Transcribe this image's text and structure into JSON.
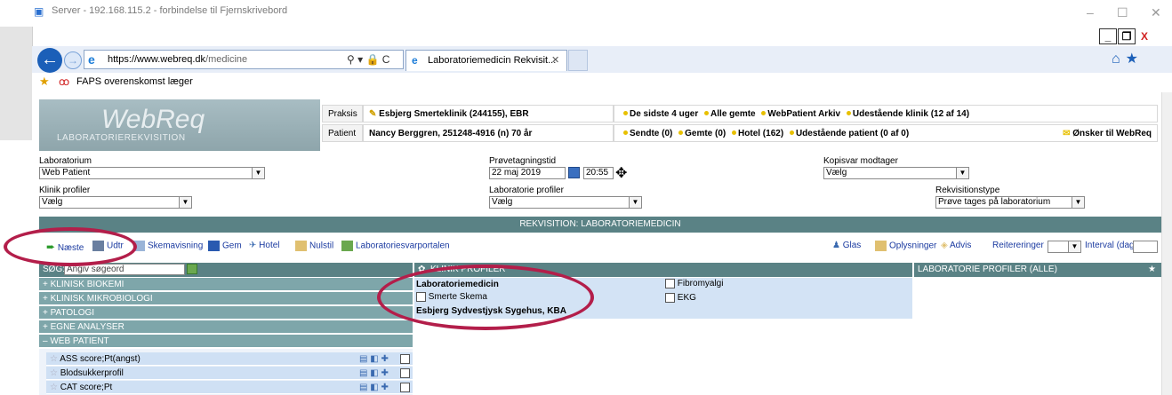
{
  "window": {
    "title": "Server - 192.168.115.2 - forbindelse til Fjernskrivebord",
    "controls": [
      "–",
      "☐",
      "✕"
    ]
  },
  "browser": {
    "url_domain": "https://www.webreq.dk",
    "url_path": "/medicine",
    "address_tools": "⚲ ▾ 🔒 C",
    "tab_title": "Laboratoriemedicin Rekvisit...",
    "tab_close": "✕",
    "favorite": "FAPS overenskomst  læger",
    "inner_controls": [
      "_",
      "❐",
      "X"
    ]
  },
  "header": {
    "brand": "WebReq",
    "subtitle": "LABORATORIEREKVISITION",
    "praksis_label": "Praksis",
    "praksis_value": "Esbjerg Smerteklinik (244155), EBR",
    "praksis_links": [
      "De sidste 4 uger",
      "Alle gemte",
      "WebPatient Arkiv",
      "Udestående klinik (12 af 14)"
    ],
    "patient_label": "Patient",
    "patient_value": "Nancy Berggren, 251248-4916 (n)  70 år",
    "patient_links": [
      "Sendte (0)",
      "Gemte (0)",
      "Hotel (162)",
      "Udestående patient (0 af 0)"
    ],
    "wish_link": "Ønsker til WebReq"
  },
  "form": {
    "laboratorium_label": "Laboratorium",
    "laboratorium_value": "Web Patient",
    "provetagning_label": "Prøvetagningstid",
    "date_value": "22 maj 2019",
    "time_value": "20:55",
    "kopisvar_label": "Kopisvar modtager",
    "kopisvar_value": "Vælg",
    "klinik_label": "Klinik profiler",
    "klinik_value": "Vælg",
    "labprof_label": "Laboratorie profiler",
    "labprof_value": "Vælg",
    "rekvtype_label": "Rekvisitionstype",
    "rekvtype_value": "Prøve tages på laboratorium"
  },
  "section_title": "REKVISITION: LABORATORIEMEDICIN",
  "toolbar": {
    "next": "Næste",
    "udtr": "Udtr",
    "skema": "Skemavisning",
    "save": "Gem",
    "hotel": "Hotel",
    "nulstil": "Nulstil",
    "portal": "Laboratoriesvarportalen",
    "glas": "Glas",
    "oplys": "Oplysninger",
    "advis": "Advis",
    "reiter": "Reitereringer",
    "interval": "Interval (dage)"
  },
  "search": {
    "label": "SØG:",
    "placeholder": "Angiv søgeord"
  },
  "categories": [
    {
      "sign": "+",
      "label": "KLINISK BIOKEMI"
    },
    {
      "sign": "+",
      "label": "KLINISK MIKROBIOLOGI"
    },
    {
      "sign": "+",
      "label": "PATOLOGI"
    },
    {
      "sign": "+",
      "label": "EGNE ANALYSER"
    },
    {
      "sign": "–",
      "label": "WEB PATIENT"
    }
  ],
  "web_patient_items": [
    "ASS score;Pt(angst)",
    "Blodsukkerprofil",
    "CAT score;Pt"
  ],
  "klinik_profiler": {
    "title": "KLINIK PROFILER",
    "group1": "Laboratoriemedicin",
    "items": [
      "Fibromyalgi",
      "Smerte Skema",
      "EKG"
    ],
    "group2": "Esbjerg Sydvestjysk Sygehus, KBA"
  },
  "lab_profiler": {
    "title": "LABORATORIE PROFILER (ALLE)"
  },
  "colors": {
    "teal": "#5a8285",
    "annotation": "#b31e4a",
    "list_blue": "#cfe0f4"
  }
}
